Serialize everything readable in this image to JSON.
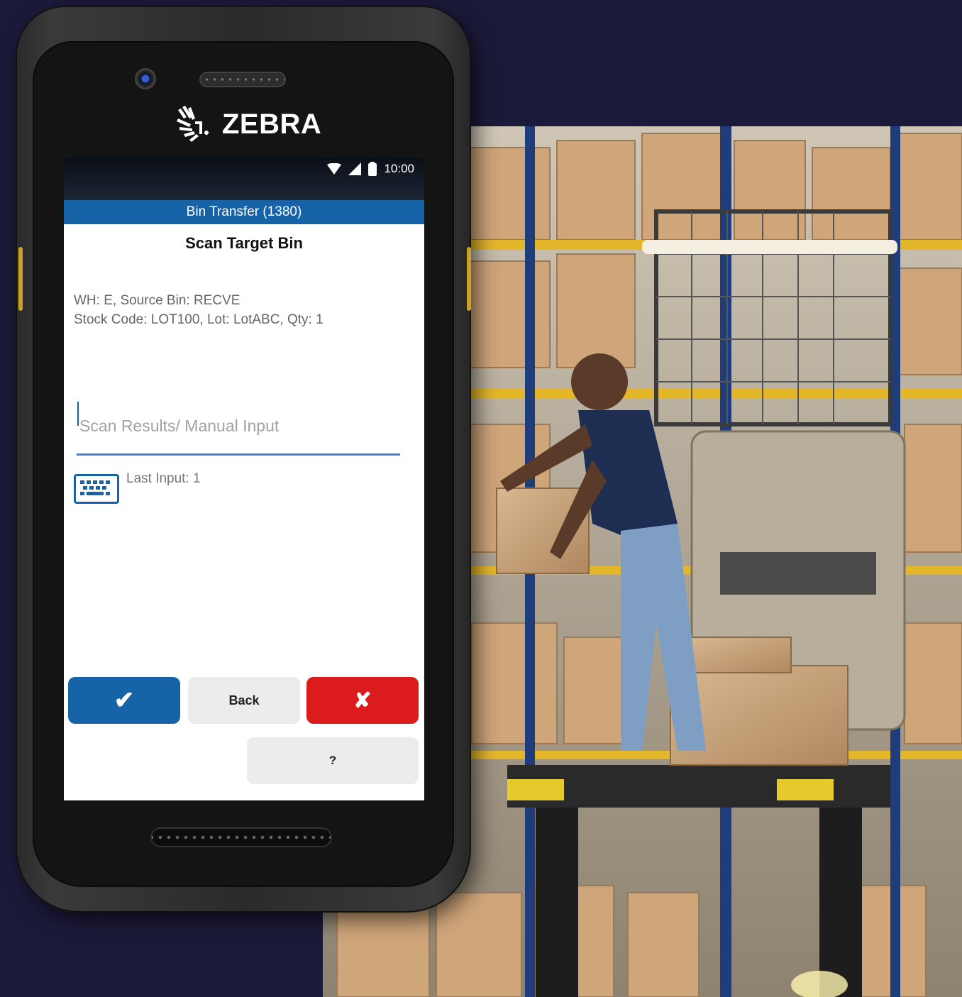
{
  "device": {
    "brand": "ZEBRA"
  },
  "statusbar": {
    "time": "10:00"
  },
  "app": {
    "title": "Bin Transfer (1380)",
    "heading": "Scan Target Bin",
    "info_line1": "WH: E, Source Bin: RECVE",
    "info_line2": "Stock Code: LOT100, Lot: LotABC, Qty: 1",
    "scan_input": {
      "value": "",
      "placeholder": "Scan Results/ Manual Input"
    },
    "last_input": "Last Input: 1"
  },
  "buttons": {
    "ok": "✔",
    "back": "Back",
    "cancel": "✘",
    "help": "?"
  },
  "colors": {
    "background": "#1c1a3a",
    "accent": "#1763a8",
    "cancel": "#dc1c1c",
    "neutral_button": "#ececec"
  },
  "icons": {
    "keyboard": "keyboard-icon",
    "wifi": "wifi-icon",
    "signal": "signal-icon",
    "battery": "battery-icon",
    "camera": "camera-icon"
  }
}
